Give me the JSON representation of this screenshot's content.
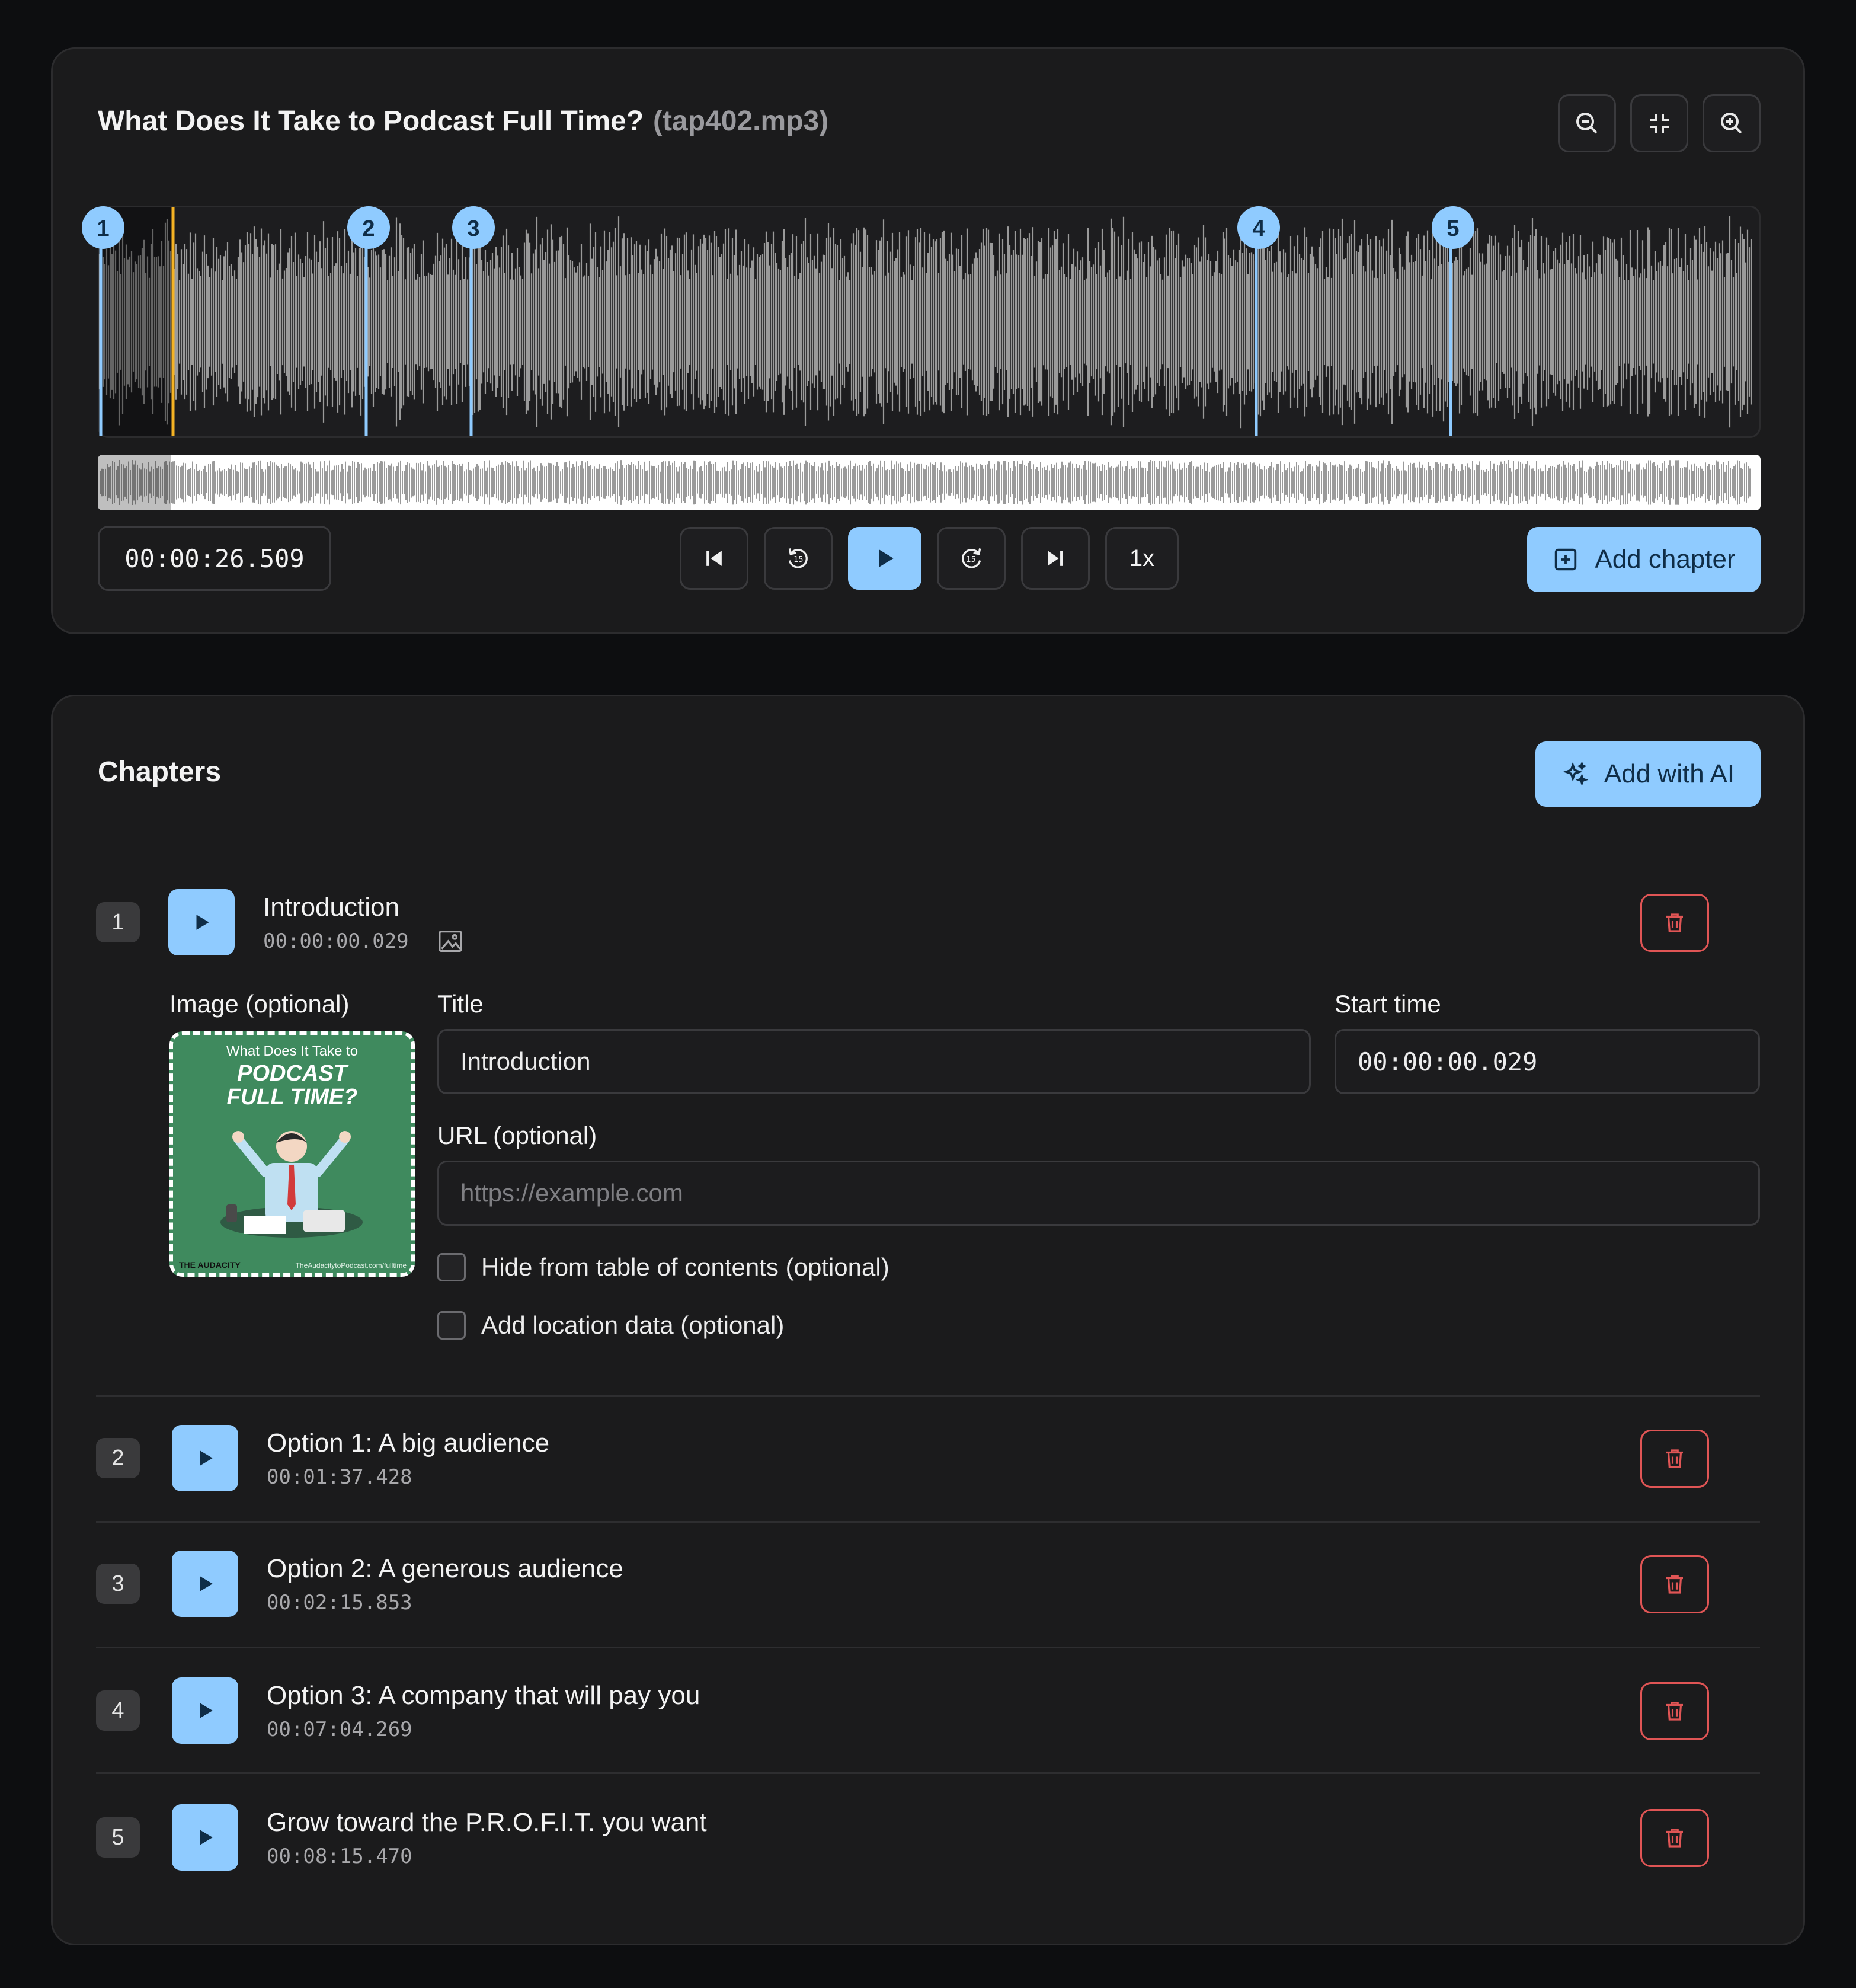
{
  "player": {
    "title": "What Does It Take to Podcast Full Time?",
    "filename": "(tap402.mp3)",
    "current_time": "00:00:26.509",
    "speed": "1x",
    "add_chapter_label": "Add chapter",
    "markers": [
      {
        "label": "1"
      },
      {
        "label": "2"
      },
      {
        "label": "3"
      },
      {
        "label": "4"
      },
      {
        "label": "5"
      }
    ],
    "colors": {
      "accent": "#8fcbff",
      "playhead": "#f5b324",
      "wave": "#9a9a9a",
      "danger": "#e05555"
    }
  },
  "chapters_panel": {
    "heading": "Chapters",
    "add_ai_label": "Add with AI",
    "expanded": {
      "image_label": "Image (optional)",
      "title_label": "Title",
      "title_value": "Introduction",
      "start_label": "Start time",
      "start_value": "00:00:00.029",
      "url_label": "URL (optional)",
      "url_placeholder": "https://example.com",
      "hide_label": "Hide from table of contents (optional)",
      "location_label": "Add location data (optional)",
      "image": {
        "line1": "What Does It Take to",
        "line2": "PODCAST",
        "line3": "FULL TIME?",
        "brand": "THE AUDACITY",
        "url": "TheAudacitytoPodcast.com/fulltime"
      }
    },
    "items": [
      {
        "num": "1",
        "title": "Introduction",
        "time": "00:00:00.029"
      },
      {
        "num": "2",
        "title": "Option 1: A big audience",
        "time": "00:01:37.428"
      },
      {
        "num": "3",
        "title": "Option 2: A generous audience",
        "time": "00:02:15.853"
      },
      {
        "num": "4",
        "title": "Option 3: A company that will pay you",
        "time": "00:07:04.269"
      },
      {
        "num": "5",
        "title": "Grow toward the P.R.O.F.I.T. you want",
        "time": "00:08:15.470"
      }
    ]
  }
}
